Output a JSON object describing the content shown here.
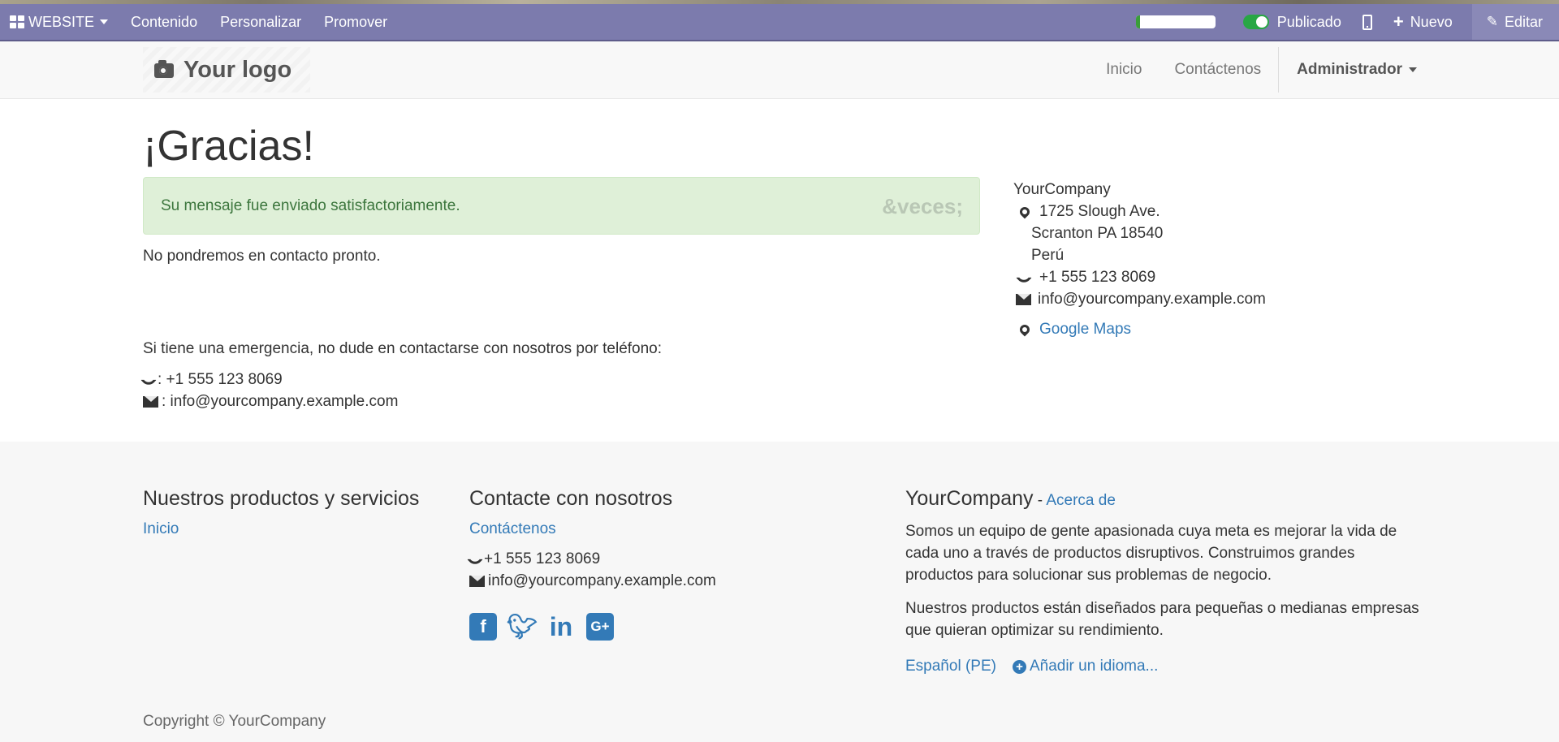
{
  "adminbar": {
    "website_label": "WEBSITE",
    "menu": [
      "Contenido",
      "Personalizar",
      "Promover"
    ],
    "progress_fraction": 0.05,
    "published_label": "Publicado",
    "new_label": "Nuevo",
    "edit_label": "Editar"
  },
  "header": {
    "logo_text": "Your logo",
    "nav": [
      "Inicio",
      "Contáctenos"
    ],
    "user_menu": "Administrador"
  },
  "main": {
    "title": "¡Gracias!",
    "alert_text": "Su mensaje fue enviado satisfactoriamente.",
    "alert_close": "&veces;",
    "contact_soon": "No pondremos en contacto pronto.",
    "emergency_text": "Si tiene una emergencia, no dude en contactarse con nosotros por teléfono:",
    "phone_line": ": +1 555 123 8069",
    "email_line": ": info@yourcompany.example.com"
  },
  "sidebar": {
    "company": "YourCompany",
    "address": [
      "1725 Slough Ave.",
      "Scranton PA 18540",
      "Perú"
    ],
    "phone": "+1 555 123 8069",
    "email": "info@yourcompany.example.com",
    "maps_link": "Google Maps"
  },
  "footer": {
    "products_title": "Nuestros productos y servicios",
    "products_link": "Inicio",
    "contact_title": "Contacte con nosotros",
    "contact_link": "Contáctenos",
    "phone": "+1 555 123 8069",
    "email": "info@yourcompany.example.com",
    "social": [
      "facebook",
      "twitter",
      "linkedin",
      "google-plus"
    ],
    "about_company": "YourCompany",
    "about_dash": " - ",
    "about_link": "Acerca de",
    "about_p1": "Somos un equipo de gente apasionada cuya meta es mejorar la vida de cada uno a través de productos disruptivos. Construimos grandes productos para solucionar sus problemas de negocio.",
    "about_p2": "Nuestros productos están diseñados para pequeñas o medianas empresas que quieran optimizar su rendimiento.",
    "language": "Español (PE)",
    "add_language": "Añadir un idioma...",
    "copyright": "Copyright © YourCompany"
  },
  "colors": {
    "adminbar": "#7c7bad",
    "link": "#337ab7",
    "alert_bg": "#dff0d8",
    "alert_text": "#3c763d",
    "published_toggle": "#28a745"
  }
}
